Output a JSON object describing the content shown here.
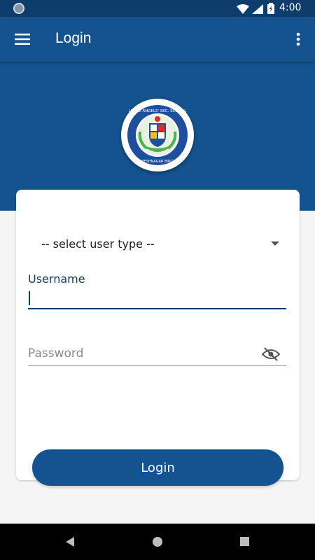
{
  "status_bar": {
    "time": "4:00",
    "icons": [
      "notification-dot-icon",
      "wifi-icon",
      "signal-icon",
      "battery-charging-icon"
    ]
  },
  "app_bar": {
    "title": "Login",
    "menu_icon": "hamburger-menu-icon",
    "overflow_icon": "more-vert-icon"
  },
  "logo": {
    "ring_text": "LITTLE ANGELS' SEC. SCHOOL",
    "bottom_text": "MAHESHNAGAR BIRGUNJ",
    "colors": {
      "ring": "#1e4f9c",
      "leaves": "#4caf50",
      "inner": "#ffffff"
    }
  },
  "form": {
    "user_type_select": {
      "value": "-- select user type --"
    },
    "username": {
      "label": "Username",
      "value": ""
    },
    "password": {
      "placeholder": "Password",
      "toggle_icon": "visibility-off-icon"
    },
    "submit_label": "Login"
  },
  "colors": {
    "primary": "#14538f",
    "primary_dark": "#0f3d6b",
    "background": "#f5f5f5",
    "card": "#ffffff"
  },
  "nav_bar": {
    "icons": [
      "back-icon",
      "home-icon",
      "recents-icon"
    ]
  }
}
